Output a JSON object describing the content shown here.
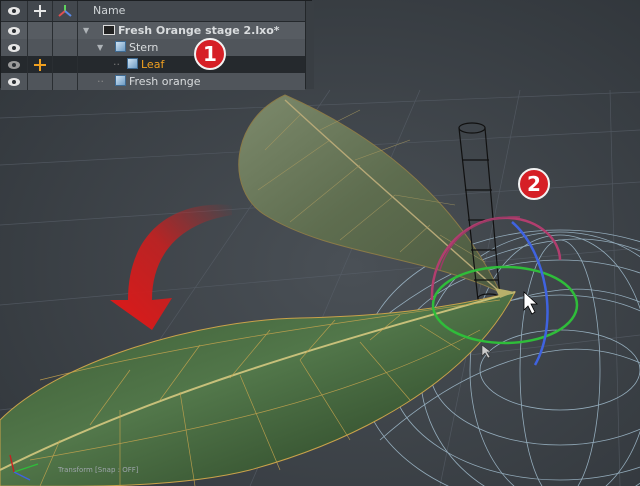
{
  "item_list": {
    "header": {
      "name_label": "Name"
    },
    "rows": [
      {
        "label": "Fresh Orange stage 2.lxo*",
        "type": "scene",
        "expanded": true,
        "bold": true
      },
      {
        "label": "Stern",
        "type": "mesh",
        "expanded": true
      },
      {
        "label": "Leaf",
        "type": "mesh",
        "selected": true,
        "color": "#f0a020"
      },
      {
        "label": "Fresh orange",
        "type": "mesh"
      }
    ]
  },
  "callouts": {
    "one": "1",
    "two": "2"
  },
  "status": {
    "transform_text": "Transform  [Snap : OFF]"
  },
  "colors": {
    "accent_orange": "#f0a020",
    "callout_red": "#d61f26",
    "arrow_red": "#cc1a1a"
  },
  "icons": [
    "eye-icon",
    "transform-icon",
    "axes-icon",
    "expand-triangle-icon",
    "scene-clapper-icon",
    "mesh-cube-icon",
    "mouse-cursor-icon"
  ]
}
